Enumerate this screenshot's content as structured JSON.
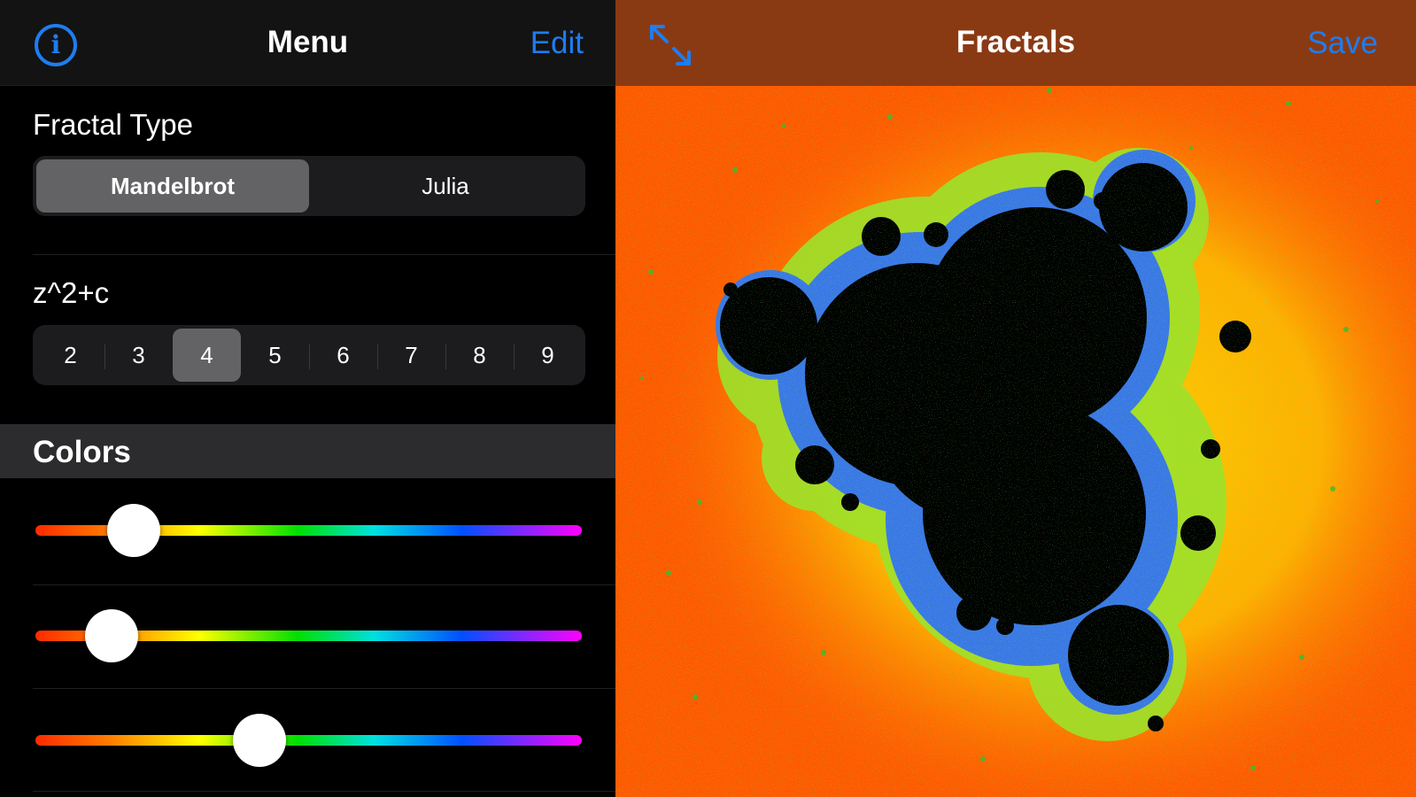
{
  "menu": {
    "title": "Menu",
    "edit_label": "Edit",
    "info_icon": "info-icon",
    "info_glyph": "i"
  },
  "fractal_type": {
    "label": "Fractal Type",
    "options": [
      "Mandelbrot",
      "Julia"
    ],
    "selected": "Mandelbrot"
  },
  "formula": {
    "label": "z^2+c",
    "options": [
      "2",
      "3",
      "4",
      "5",
      "6",
      "7",
      "8",
      "9"
    ],
    "selected": "4"
  },
  "colors": {
    "header": "Colors",
    "sliders": [
      {
        "name": "color-slider-1",
        "value": 0.18
      },
      {
        "name": "color-slider-2",
        "value": 0.14
      },
      {
        "name": "color-slider-3",
        "value": 0.41
      }
    ]
  },
  "viewer": {
    "title": "Fractals",
    "save_label": "Save",
    "expand_icon": "expand-icon"
  },
  "theme": {
    "accent": "#1e7df0",
    "viewer_nav_bg": "#8a3a13",
    "fractal_background": "#ff5a00"
  }
}
